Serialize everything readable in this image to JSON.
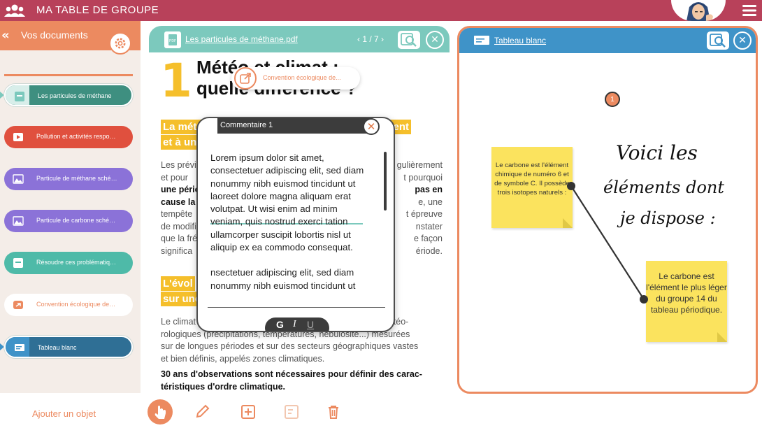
{
  "app": {
    "title": "MA TABLE DE GROUPE",
    "accent": "#b8415a"
  },
  "sidebar": {
    "title": "Vos documents",
    "add_object_label": "Ajouter un objet",
    "items": [
      {
        "label": "Les particules de méthane",
        "color": "#3e8f80",
        "active": true
      },
      {
        "label": "Pollution et activités respo…",
        "color": "#e0503e",
        "active": false
      },
      {
        "label": "Particule de méthane sché…",
        "color": "#8b72d8",
        "active": false
      },
      {
        "label": "Particule de carbone sché…",
        "color": "#8b72d8",
        "active": false
      },
      {
        "label": "Résoudre ces problématiq…",
        "color": "#4ebaa8",
        "active": false
      },
      {
        "label": "Convention écologique de…",
        "color": "#ffffff",
        "active": false
      },
      {
        "label": "Tableau blanc",
        "color": "#2f6f95",
        "active": true
      }
    ]
  },
  "document": {
    "file_name": "Les particules de méthane.pdf",
    "pager": "1 / 7",
    "big_number": "1",
    "title_line1": "Météo et climat :",
    "title_line2": "quelle différence ?",
    "heading1_line1": "La météo ",
    "heading1_line1_end": "oment",
    "heading1_line2": "et à un endroit donné",
    "para1": [
      "Les prévi",
      "et pour",
      "une pério",
      "cause la",
      "tempête",
      "de modifi",
      "que la fré",
      "significa"
    ],
    "para1_right": [
      "gulièrement",
      "t pourquoi",
      "pas en",
      "e, une",
      "t épreuve",
      "nstater",
      "e façon",
      "ériode."
    ],
    "heading2_line1": "L'évol",
    "heading2_line2": "sur une plus longue période",
    "para2": [
      "Le climat désigne les valeurs moyennes des paramètres météo-",
      "rologiques (précipitations, températures, nébulosité...) mesurées",
      "sur de longues périodes et sur des secteurs géographiques vastes",
      "et bien définis, appelés zones climatiques."
    ],
    "para3": [
      "30 ans d'observations sont nécessaires pour définir des carac-",
      "téristiques d'ordre climatique."
    ]
  },
  "convention_popup": {
    "label": "Convention écologique de..."
  },
  "comment": {
    "title": "Commentaire 1",
    "body_p1": "Lorem ipsum dolor sit amet, consectetuer adipiscing elit, sed diam nonummy nibh euismod tincidunt ut laoreet dolore magna aliquam erat volutpat. Ut wisi enim ad minim veniam, quis nostrud exerci tation ullamcorper suscipit lobortis nisl ut aliquip ex ea commodo consequat.",
    "body_p2": "nsectetuer adipiscing elit, sed diam nonummy nibh euismod tincidunt ut",
    "bold_label": "G",
    "italic_label": "I",
    "underline_label": "U"
  },
  "whiteboard": {
    "title": "Tableau blanc",
    "comment_pin": "1",
    "sticky1": "Le carbone est l'élément chimique de numéro 6 et de symbole C. Il possède trois isotopes naturels :",
    "sticky2": "Le carbone est l'élément le plus léger du groupe 14 du tableau périodique.",
    "handwriting_line1": "Voici les",
    "handwriting_line2": "éléments dont",
    "handwriting_line3": "je dispose :"
  }
}
